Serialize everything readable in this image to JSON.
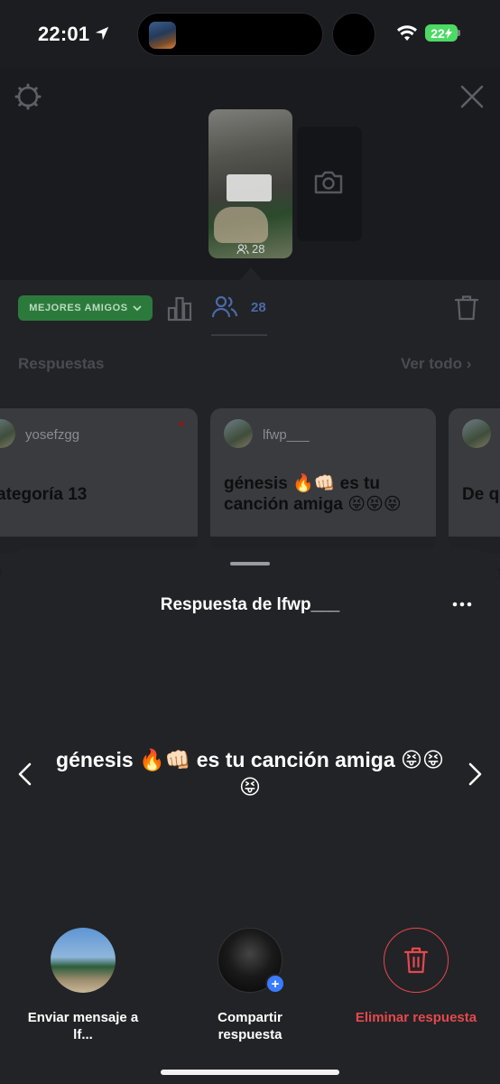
{
  "status_bar": {
    "time": "22:01",
    "battery": "22"
  },
  "story": {
    "viewer_count": "28"
  },
  "toolbar": {
    "audience_label": "MEJORES AMIGOS",
    "viewers_count": "28"
  },
  "responses": {
    "title": "Respuestas",
    "see_all": "Ver todo",
    "cards": [
      {
        "user": "yosefzgg",
        "text": "ategoría 13"
      },
      {
        "user": "lfwp___",
        "text": "génesis 🔥👊🏻 es tu canción amiga 😝😝😝"
      },
      {
        "user": "",
        "text": "De q"
      }
    ]
  },
  "sheet": {
    "title": "Respuesta de lfwp___",
    "answer": "génesis 🔥👊🏻 es tu canción amiga 😝😝😝",
    "actions": {
      "message": "Enviar mensaje a lf...",
      "share": "Compartir respuesta",
      "delete": "Eliminar respuesta"
    }
  },
  "colors": {
    "accent_blue": "#3a7bff",
    "danger": "#e5484d",
    "audience_green": "#2b7a3c"
  }
}
